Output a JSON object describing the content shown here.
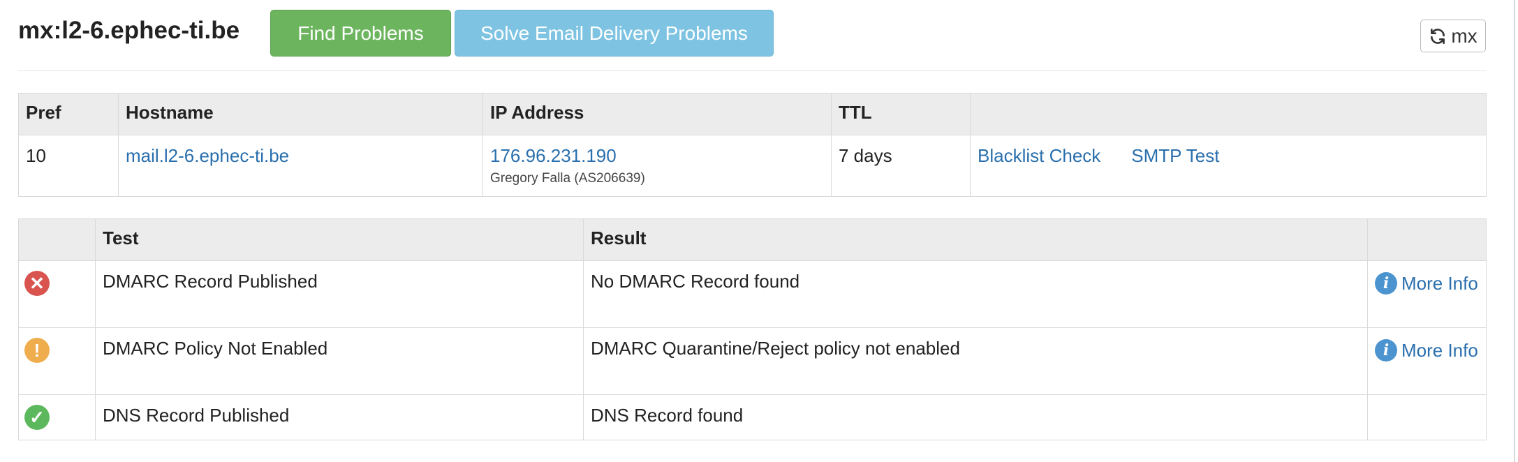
{
  "header": {
    "title": "mx:l2-6.ephec-ti.be",
    "find_button": "Find Problems",
    "solve_button": "Solve Email Delivery Problems",
    "refresh_button": "mx",
    "refresh_icon": "refresh-icon"
  },
  "mx_table": {
    "headers": [
      "Pref",
      "Hostname",
      "IP Address",
      "TTL",
      ""
    ],
    "rows": [
      {
        "pref": "10",
        "hostname": "mail.l2-6.ephec-ti.be",
        "ip": "176.96.231.190",
        "owner": "Gregory Falla (AS206639)",
        "ttl": "7 days",
        "blacklist_link": "Blacklist Check",
        "smtp_link": "SMTP Test"
      }
    ]
  },
  "test_table": {
    "headers": [
      "",
      "Test",
      "Result",
      ""
    ],
    "rows": [
      {
        "status": "error",
        "status_icon": "x-circle-icon",
        "status_color": "#d9534f",
        "test": "DMARC Record Published",
        "result": "No DMARC Record found",
        "more_info": "More Info"
      },
      {
        "status": "warning",
        "status_icon": "exclamation-circle-icon",
        "status_color": "#f0ad4e",
        "test": "DMARC Policy Not Enabled",
        "result": "DMARC Quarantine/Reject policy not enabled",
        "more_info": "More Info"
      },
      {
        "status": "ok",
        "status_icon": "check-circle-icon",
        "status_color": "#5cb85c",
        "test": "DNS Record Published",
        "result": "DNS Record found",
        "more_info": ""
      }
    ]
  },
  "colors": {
    "link": "#2a6fad",
    "find_button": "#6cb55e",
    "solve_button": "#7ec4e2",
    "info_icon": "#4c94cf"
  }
}
